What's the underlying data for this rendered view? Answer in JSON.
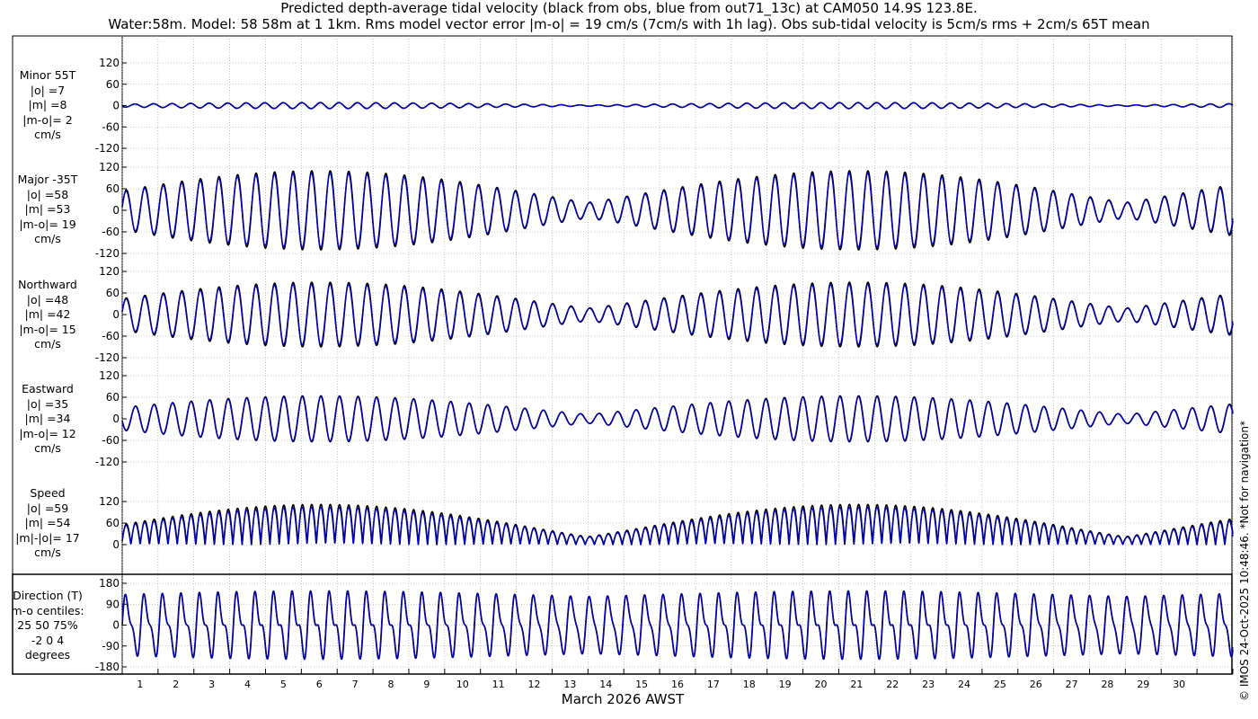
{
  "title_line1": "Predicted depth-average tidal velocity (black from obs, blue from out71_13c) at CAM050 14.9S 123.8E.",
  "title_line2": "Water:58m. Model: 58 58m at 1 1km. Rms model vector error |m-o| = 19 cm/s (7cm/s with 1h lag). Obs sub-tidal velocity is 5cm/s rms + 2cm/s 65T mean",
  "xaxis_label": "March 2026 AWST",
  "credit": "© IMOS 24-Oct-2025 10:48:46. *Not for navigation*",
  "colors": {
    "obs": "#000000",
    "model": "#0000cc",
    "grid": "#9a9a9a"
  },
  "chart_data": {
    "type": "line",
    "x_ticks": [
      "1",
      "2",
      "3",
      "4",
      "5",
      "6",
      "7",
      "8",
      "9",
      "10",
      "11",
      "12",
      "13",
      "14",
      "15",
      "16",
      "17",
      "18",
      "19",
      "20",
      "21",
      "22",
      "23",
      "24",
      "25",
      "26",
      "27",
      "28",
      "29",
      "30"
    ],
    "xlim": [
      0,
      31
    ],
    "series_names": [
      "obs",
      "model"
    ],
    "panels": [
      {
        "id": "minor",
        "label": "Minor 55T\n|o| =7\n|m| =8\n|m-o|= 2\ncm/s",
        "yticks": [
          "120",
          "60",
          "0",
          "-60",
          "-120"
        ],
        "ylim": [
          -120,
          120
        ],
        "series": [
          {
            "name": "obs",
            "amplitude": 8,
            "phase_deg": 200
          },
          {
            "name": "model",
            "amplitude": 9,
            "phase_deg": 205
          }
        ]
      },
      {
        "id": "major",
        "label": "Major -35T\n|o| =58\n|m| =53\n|m-o|= 19\ncm/s",
        "yticks": [
          "120",
          "60",
          "0",
          "-60",
          "-120"
        ],
        "ylim": [
          -120,
          120
        ],
        "series": [
          {
            "name": "obs",
            "amplitude": 110,
            "phase_deg": 10
          },
          {
            "name": "model",
            "amplitude": 103,
            "phase_deg": 15
          }
        ]
      },
      {
        "id": "north",
        "label": "Northward\n|o| =48\n|m| =42\n|m-o|= 15\ncm/s",
        "yticks": [
          "120",
          "60",
          "0",
          "-60",
          "-120"
        ],
        "ylim": [
          -120,
          120
        ],
        "series": [
          {
            "name": "obs",
            "amplitude": 90,
            "phase_deg": 10
          },
          {
            "name": "model",
            "amplitude": 84,
            "phase_deg": 15
          }
        ]
      },
      {
        "id": "east",
        "label": "Eastward\n|o| =35\n|m| =34\n|m-o|= 12\ncm/s",
        "yticks": [
          "120",
          "60",
          "0",
          "-60",
          "-120"
        ],
        "ylim": [
          -120,
          120
        ],
        "series": [
          {
            "name": "obs",
            "amplitude": 64,
            "phase_deg": 190
          },
          {
            "name": "model",
            "amplitude": 62,
            "phase_deg": 195
          }
        ]
      },
      {
        "id": "speed",
        "label": "Speed\n|o| =59\n|m| =54\n|m|-|o|= 17\ncm/s",
        "yticks": [
          "120",
          "60",
          "0"
        ],
        "ylim": [
          0,
          120
        ],
        "series": [
          {
            "name": "obs",
            "amplitude": 112,
            "phase_deg": 10
          },
          {
            "name": "model",
            "amplitude": 104,
            "phase_deg": 15
          }
        ]
      },
      {
        "id": "direction",
        "label": "Direction (T)\nm-o centiles:\n25  50  75%\n-2  0  4\ndegrees",
        "yticks": [
          "180",
          "90",
          "0",
          "-90",
          "-180"
        ],
        "ylim": [
          -180,
          180
        ],
        "series": [
          {
            "name": "obs",
            "phase_deg": 0
          },
          {
            "name": "model",
            "phase_deg": 5
          }
        ]
      }
    ]
  }
}
